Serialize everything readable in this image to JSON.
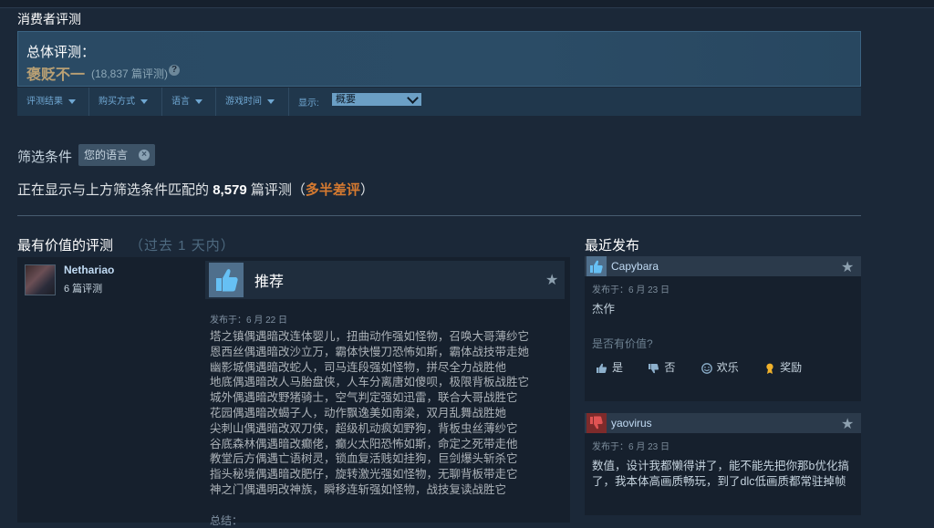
{
  "section_title": "消费者评测",
  "summary": {
    "label": "总体评测：",
    "score": "褒贬不一",
    "count": "(18,837 篇评测)",
    "help": "?"
  },
  "filters": {
    "items": [
      "评测结果",
      "购买方式",
      "语言",
      "游戏时间"
    ],
    "display_label": "显示:",
    "display_value": "概要"
  },
  "active_filters": {
    "label": "筛选条件",
    "chip": "您的语言",
    "chip_close": "×"
  },
  "filter_summary": {
    "prefix": "正在显示与上方筛选条件匹配的",
    "count": "8,579",
    "mid": "篇评测（",
    "rating": "多半差评",
    "suffix": "）"
  },
  "left_column": {
    "title": "最有价值的评测",
    "period": "（过去 1 天内）"
  },
  "right_column": {
    "title": "最近发布"
  },
  "review": {
    "author": "Nethariao",
    "author_reviews": "6 篇评测",
    "vote": "推荐",
    "posted": "发布于：6 月 22 日",
    "body": "塔之镇偶遇暗改连体婴儿，扭曲动作强如怪物，召唤大哥薄纱它\n恩西丝偶遇暗改沙立万，霸体快慢刀恐怖如斯，霸体战技带走她\n幽影城偶遇暗改蛇人，司马连段强如怪物，拼尽全力战胜他\n地底偶遇暗改人马胎盘侠，人车分离唐如傻呗，极限背板战胜它\n城外偶遇暗改野猪骑士，空气判定强如迅雷，联合大哥战胜它\n花园偶遇暗改蝎子人，动作飘逸美如南梁，双月乱舞战胜她\n尖刺山偶遇暗改双刀侠，超级机动疯如野狗，背板虫丝薄纱它\n谷底森林偶遇暗改癫佬，癫火太阳恐怖如斯，命定之死带走他\n教堂后方偶遇亡语树灵，锁血复活贱如挂狗，巨剑爆头斩杀它\n指头秘境偶遇暗改肥仔，旋转激光强如怪物，无聊背板带走它\n神之门偶遇明改神族，瞬移连斩强如怪物，战技复读战胜它",
    "tail": "总结："
  },
  "recent": [
    {
      "author": "Capybara",
      "date": "发布于：6 月 23 日",
      "text": "杰作",
      "helpful_q": "是否有价值?",
      "actions": [
        "是",
        "否",
        "欢乐",
        "奖励"
      ],
      "positive": true
    },
    {
      "author": "yaovirus",
      "date": "发布于：6 月 23 日",
      "text": "数值，设计我都懒得讲了，能不能先把你那b优化搞了，我本体高画质畅玩，到了dlc低画质都常驻掉帧",
      "positive": false
    }
  ],
  "colors": {
    "background": "#1b2838",
    "mixed": "#b9a074",
    "mostly_negative": "#d67a30",
    "link": "#6fa7d2",
    "positive_thumb": "#66c0f4",
    "negative_thumb": "#c23b3b"
  },
  "icons": [
    "help-icon",
    "thumbs-up-icon",
    "thumbs-down-icon",
    "star-icon",
    "smile-icon",
    "award-icon",
    "close-icon",
    "caret-down-icon"
  ]
}
